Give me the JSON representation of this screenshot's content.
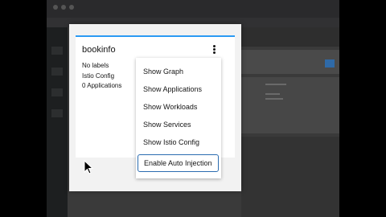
{
  "card": {
    "title": "bookinfo",
    "labels_text": "No labels",
    "config_text": "Istio Config",
    "applications_text": "0 Applications"
  },
  "menu": {
    "items": [
      {
        "label": "Show Graph"
      },
      {
        "label": "Show Applications"
      },
      {
        "label": "Show Workloads"
      },
      {
        "label": "Show Services"
      },
      {
        "label": "Show Istio Config"
      }
    ],
    "highlighted": {
      "label": "Enable Auto Injection"
    }
  },
  "icons": {
    "kebab": "kebab-menu-icon",
    "cursor": "mouse-pointer-icon"
  },
  "colors": {
    "accent_top_border": "#2b9af3",
    "focus_outline": "#2b6cb0",
    "card_background": "#ffffff",
    "modal_background": "#f2f2f2"
  }
}
